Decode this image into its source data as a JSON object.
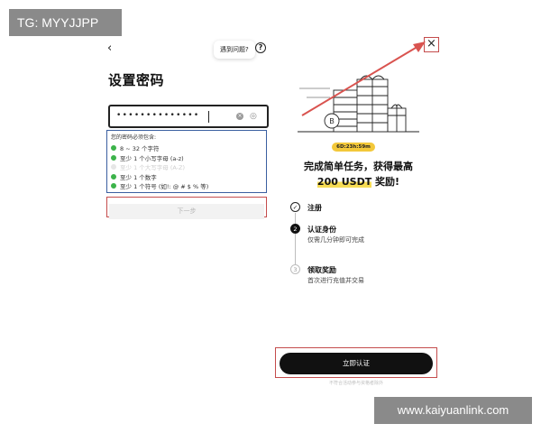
{
  "watermarks": {
    "top": "TG: MYYJJPP",
    "bottom": "www.kaiyuanlink.com"
  },
  "left": {
    "back_glyph": "‹",
    "help_label": "遇到问题?",
    "help_glyph": "?",
    "title": "设置密码",
    "password": {
      "value": "••••••••••••••"
    },
    "clear_glyph": "×",
    "eye_glyph": "◎",
    "rules_heading": "您的密码必须包含:",
    "rules": [
      {
        "text": "8 ~ 32 个字符",
        "met": true
      },
      {
        "text": "至少 1 个小写字母 (a-z)",
        "met": true
      },
      {
        "text": "至少 1 个大写字母 (A-Z)",
        "met": false
      },
      {
        "text": "至少 1 个数字",
        "met": true
      },
      {
        "text": "至少 1 个符号 (如!: @ # $ % 等)",
        "met": true
      }
    ],
    "next_label": "下一步"
  },
  "right": {
    "close_glyph": "×",
    "timer": "6D:23h:59m",
    "promo_line1": "完成简单任务，获得最高",
    "promo_amount": "200 USDT",
    "promo_suffix": " 奖励!",
    "steps": [
      {
        "num": "✓",
        "title": "注册",
        "sub": ""
      },
      {
        "num": "2",
        "title": "认证身份",
        "sub": "仅需几分钟即可完成"
      },
      {
        "num": "3",
        "title": "领取奖励",
        "sub": "首次进行充值并交易"
      }
    ],
    "cta_label": "立即认证",
    "foot_note": "不符合活动参与资格者除外"
  },
  "colors": {
    "highlight_red": "#c44c4c",
    "rule_box_blue": "#3a5fa0",
    "check_green": "#3cb34a",
    "timer_yellow": "#f3c83a"
  },
  "icons": [
    "back-chevron-icon",
    "help-icon",
    "clear-icon",
    "eye-off-icon",
    "close-icon",
    "check-icon"
  ]
}
